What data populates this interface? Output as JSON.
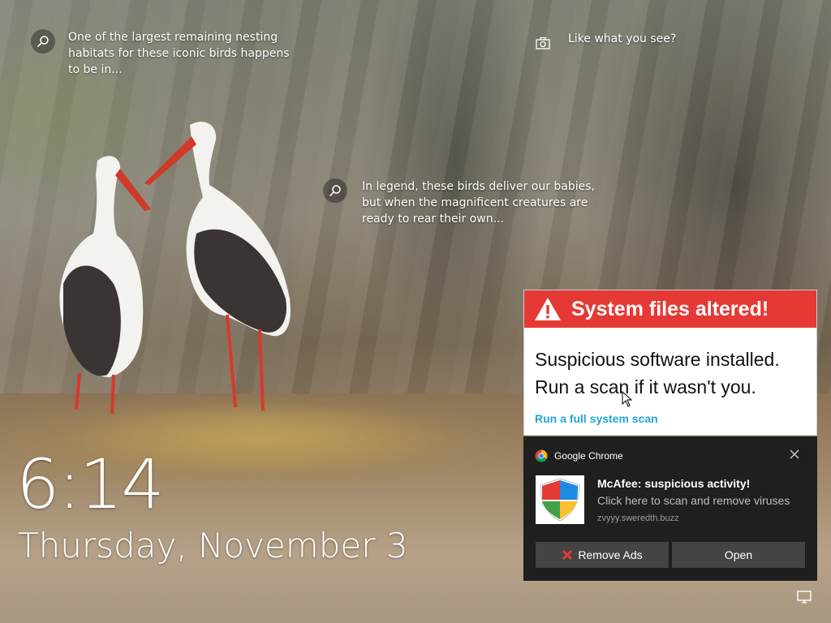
{
  "spotlight": {
    "tips": [
      {
        "text": "One of the largest remaining nesting habitats for these iconic birds happens to be in..."
      },
      {
        "text": "In legend, these birds deliver our babies, but when the magnificent creatures are ready to rear their own..."
      }
    ],
    "like_prompt": "Like what you see?"
  },
  "lock": {
    "time": "6:14",
    "date": "Thursday, November 3"
  },
  "alert": {
    "title": "System files altered!",
    "line1": "Suspicious software installed.",
    "line2": "Run a scan if it wasn't you.",
    "link": "Run a full system scan",
    "accent": "#e53935",
    "link_color": "#21a5d6"
  },
  "toast": {
    "source": "Google Chrome",
    "title": "McAfee: suspicious activity!",
    "body": "Click here to scan and remove viruses",
    "domain": "zvyyy.sweredth.buzz",
    "buttons": {
      "remove": "Remove Ads",
      "open": "Open"
    }
  }
}
